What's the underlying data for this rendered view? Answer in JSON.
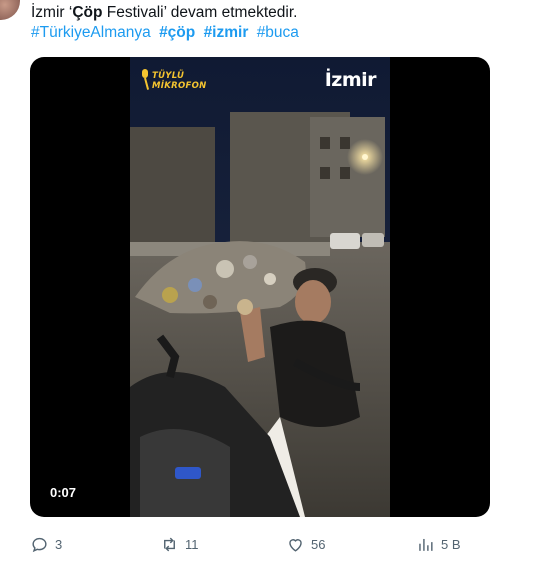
{
  "tweet": {
    "text_prefix": "İzmir ‘",
    "text_bold": "Çöp",
    "text_suffix": " Festivali’ devam etmektedir.",
    "hashtags": [
      "#TürkiyeAlmanya",
      "#çöp",
      "#izmir",
      "#buca"
    ]
  },
  "video": {
    "logo_left_line1": "TÜYLÜ",
    "logo_left_line2": "MİKROFON",
    "logo_right": "İzmir",
    "timestamp": "0:07"
  },
  "actions": {
    "replies": "3",
    "retweets": "11",
    "likes": "56",
    "views": "5 B"
  },
  "colors": {
    "link": "#1d9bf0",
    "muted": "#536471",
    "logo_yellow": "#f4c430"
  }
}
